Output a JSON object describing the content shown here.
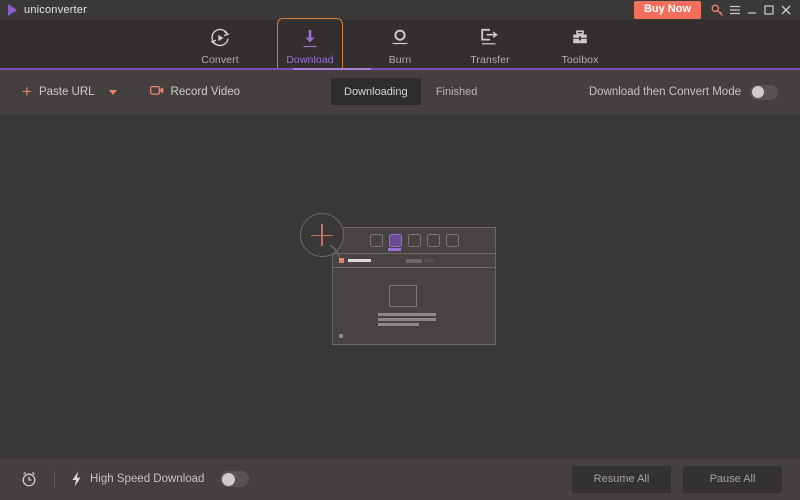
{
  "window": {
    "app_name": "uniconverter",
    "logo_icon": "play-triangle-icon",
    "buy_now_label": "Buy Now",
    "controls": [
      {
        "name": "key-icon",
        "glyph": "key"
      },
      {
        "name": "menu-icon",
        "glyph": "hamburger"
      },
      {
        "name": "minimize-icon",
        "glyph": "minimize"
      },
      {
        "name": "maximize-icon",
        "glyph": "maximize"
      },
      {
        "name": "close-icon",
        "glyph": "close"
      }
    ]
  },
  "nav": {
    "active": "Download",
    "items": [
      {
        "label": "Convert",
        "icon": "convert-circular-play-icon"
      },
      {
        "label": "Download",
        "icon": "download-arrow-icon"
      },
      {
        "label": "Burn",
        "icon": "burn-disc-icon"
      },
      {
        "label": "Transfer",
        "icon": "transfer-arrow-out-icon"
      },
      {
        "label": "Toolbox",
        "icon": "toolbox-briefcase-icon"
      }
    ]
  },
  "toolbar": {
    "paste_url_label": "Paste URL",
    "paste_url_icon": "plus-icon",
    "paste_url_caret": "chevron-down-icon",
    "record_video_label": "Record Video",
    "record_video_icon": "video-camera-icon",
    "tabs": [
      {
        "label": "Downloading",
        "active": true
      },
      {
        "label": "Finished",
        "active": false
      }
    ],
    "convert_mode_label": "Download then Convert Mode",
    "convert_mode_on": false
  },
  "content": {
    "illustration": {
      "name": "empty-state-browser-illustration",
      "magnifier_icon": "magnifier-plus-icon",
      "browser_tab_count": 5,
      "browser_selected_tab_index": 1
    }
  },
  "bottom": {
    "alarm_icon": "alarm-clock-icon",
    "high_speed_icon": "lightning-bolt-icon",
    "high_speed_label": "High Speed Download",
    "high_speed_on": false,
    "resume_all_label": "Resume All",
    "pause_all_label": "Pause All"
  },
  "colors": {
    "accent_purple": "#8d5cc8",
    "accent_orange": "#d97b32",
    "buy_now": "#f0705d",
    "coral": "#e8836c",
    "titlebar_bg": "#3b3838",
    "nav_bg": "#332f2f",
    "toolbar_bg": "#444040",
    "content_bg": "#3a3737"
  }
}
